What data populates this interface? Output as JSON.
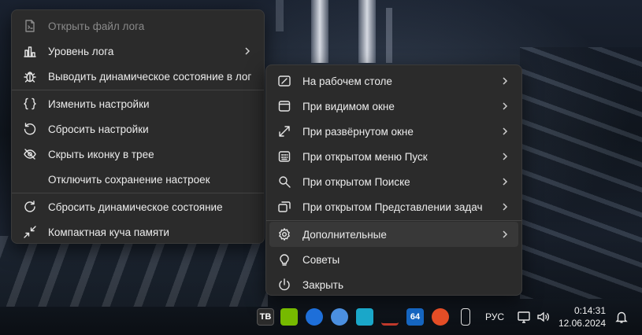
{
  "left_menu": {
    "items": [
      {
        "label": "Открыть файл лога",
        "icon": "file-log-icon",
        "disabled": true
      },
      {
        "label": "Уровень лога",
        "icon": "bar-chart-icon",
        "submenu": true
      },
      {
        "label": "Выводить динамическое состояние в лог",
        "icon": "bug-icon"
      },
      {
        "label": "Изменить настройки",
        "icon": "braces-icon"
      },
      {
        "label": "Сбросить настройки",
        "icon": "reset-icon"
      },
      {
        "label": "Скрыть иконку в трее",
        "icon": "eye-off-icon"
      },
      {
        "label": "Отключить сохранение настроек",
        "icon": ""
      },
      {
        "label": "Сбросить динамическое состояние",
        "icon": "refresh-icon"
      },
      {
        "label": "Компактная куча памяти",
        "icon": "compress-icon"
      }
    ]
  },
  "right_menu": {
    "items": [
      {
        "label": "На рабочем столе",
        "icon": "desktop-icon",
        "submenu": true
      },
      {
        "label": "При видимом окне",
        "icon": "window-icon",
        "submenu": true
      },
      {
        "label": "При развёрнутом окне",
        "icon": "maximize-icon",
        "submenu": true
      },
      {
        "label": "При открытом меню Пуск",
        "icon": "start-menu-icon",
        "submenu": true
      },
      {
        "label": "При открытом Поиске",
        "icon": "search-icon",
        "submenu": true
      },
      {
        "label": "При открытом Представлении задач",
        "icon": "task-view-icon",
        "submenu": true
      },
      {
        "label": "Дополнительные",
        "icon": "gear-icon",
        "submenu": true,
        "hover": true
      },
      {
        "label": "Советы",
        "icon": "lightbulb-icon"
      },
      {
        "label": "Закрыть",
        "icon": "power-icon"
      }
    ]
  },
  "taskbar": {
    "tray_icons": [
      {
        "name": "tb-app-icon",
        "text": "TB",
        "color": "#2b2b2b"
      },
      {
        "name": "nvidia-icon",
        "text": "",
        "color": "#76b900"
      },
      {
        "name": "network-app-icon",
        "text": "",
        "color": "#1e6fd9"
      },
      {
        "name": "globe-app-icon",
        "text": "",
        "color": "#4b8fe0"
      },
      {
        "name": "monitor-app-icon",
        "text": "",
        "color": "#1aa7c9"
      },
      {
        "name": "arrows-app-icon",
        "text": "",
        "color": "#c0392b"
      },
      {
        "name": "aida64-icon",
        "text": "64",
        "color": "#1565c0"
      },
      {
        "name": "pinwheel-app-icon",
        "text": "",
        "color": "#e44d26"
      },
      {
        "name": "usb-icon",
        "text": "",
        "color": "#dddddd"
      }
    ],
    "language": "РУС",
    "time": "0:14:31",
    "date": "12.06.2024"
  }
}
